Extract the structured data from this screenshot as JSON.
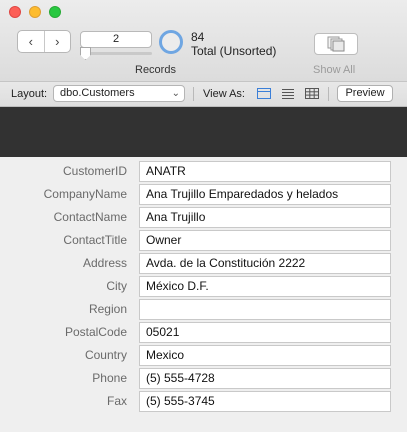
{
  "toolbar": {
    "current_record": "2",
    "record_count": "84",
    "total_label": "Total (Unsorted)",
    "records_label": "Records",
    "show_all_label": "Show All",
    "back_glyph": "‹",
    "forward_glyph": "›",
    "progress_fraction": 0.024
  },
  "layoutbar": {
    "layout_label": "Layout:",
    "layout_value": "dbo.Customers",
    "view_as_label": "View As:",
    "preview_label": "Preview",
    "active_view": "form-view-icon"
  },
  "fields": [
    {
      "label": "CustomerID",
      "value": "ANATR"
    },
    {
      "label": "CompanyName",
      "value": "Ana Trujillo Emparedados y helados"
    },
    {
      "label": "ContactName",
      "value": "Ana Trujillo"
    },
    {
      "label": "ContactTitle",
      "value": "Owner"
    },
    {
      "label": "Address",
      "value": "Avda. de la Constitución 2222"
    },
    {
      "label": "City",
      "value": "México D.F."
    },
    {
      "label": "Region",
      "value": ""
    },
    {
      "label": "PostalCode",
      "value": "05021"
    },
    {
      "label": "Country",
      "value": "Mexico"
    },
    {
      "label": "Phone",
      "value": "(5) 555-4728"
    },
    {
      "label": "Fax",
      "value": "(5) 555-3745"
    }
  ],
  "colors": {
    "header_band": "#323232",
    "accent": "#4a90e2",
    "close": "#fc5f57",
    "minimize": "#fdbc2e",
    "maximize": "#28c840"
  }
}
